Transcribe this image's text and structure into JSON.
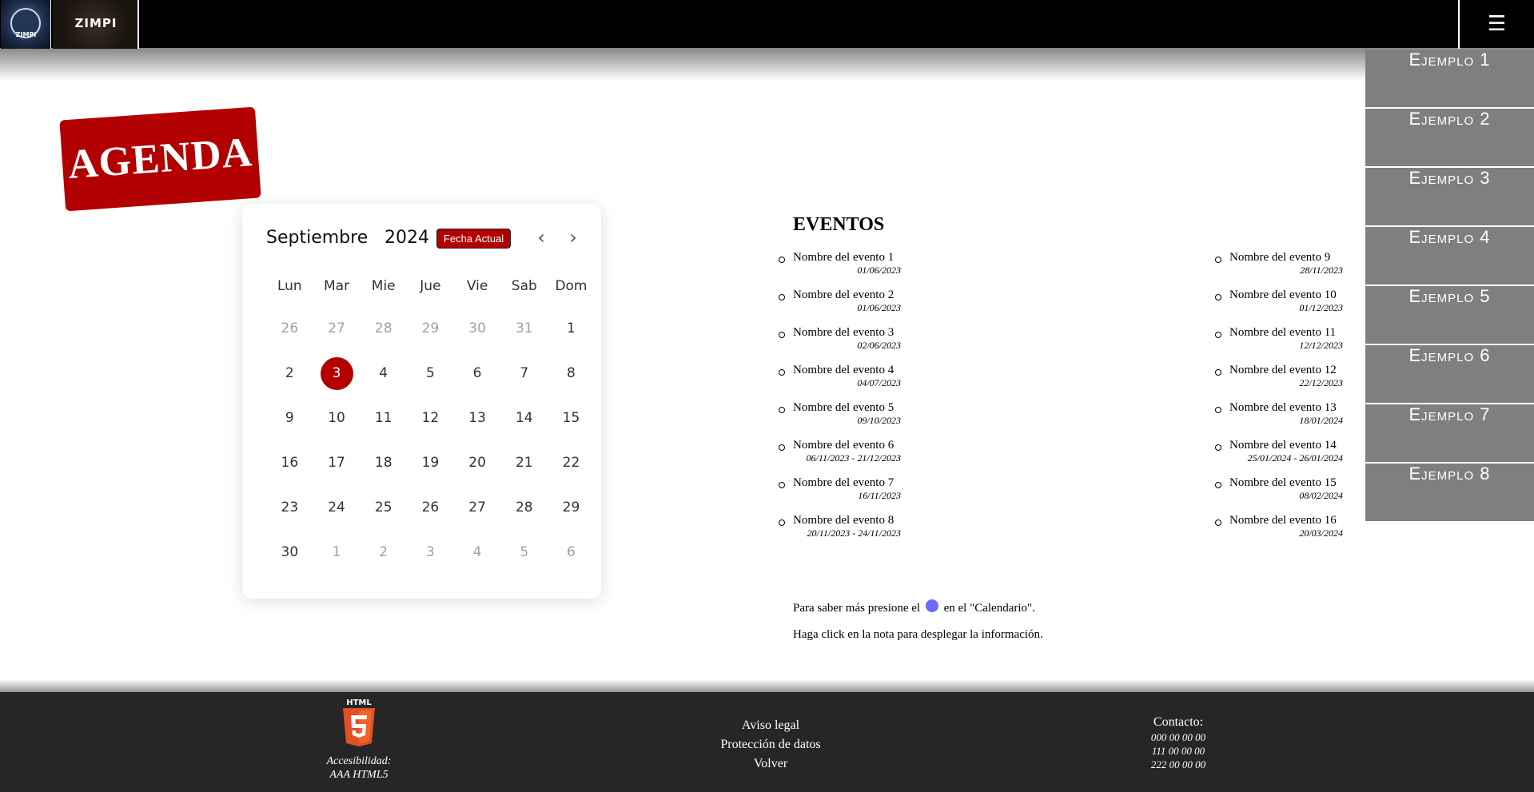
{
  "header": {
    "logo1_text": "ZIMPI",
    "logo2_text": "ZIMPI",
    "menu_icon": "☰"
  },
  "side_menu": [
    "Ejemplo 1",
    "Ejemplo 2",
    "Ejemplo 3",
    "Ejemplo 4",
    "Ejemplo 5",
    "Ejemplo 6",
    "Ejemplo 7",
    "Ejemplo 8"
  ],
  "stamp": "AGENDA",
  "calendar": {
    "month": "Septiembre",
    "year": "2024",
    "today_button": "Fecha Actual",
    "prev_icon": "‹",
    "next_icon": "›",
    "weekdays": [
      "Lun",
      "Mar",
      "Mie",
      "Jue",
      "Vie",
      "Sab",
      "Dom"
    ],
    "days": [
      {
        "d": "26",
        "m": true
      },
      {
        "d": "27",
        "m": true
      },
      {
        "d": "28",
        "m": true
      },
      {
        "d": "29",
        "m": true
      },
      {
        "d": "30",
        "m": true
      },
      {
        "d": "31",
        "m": true
      },
      {
        "d": "1"
      },
      {
        "d": "2"
      },
      {
        "d": "3",
        "sel": true
      },
      {
        "d": "4"
      },
      {
        "d": "5"
      },
      {
        "d": "6"
      },
      {
        "d": "7"
      },
      {
        "d": "8"
      },
      {
        "d": "9"
      },
      {
        "d": "10"
      },
      {
        "d": "11"
      },
      {
        "d": "12"
      },
      {
        "d": "13"
      },
      {
        "d": "14"
      },
      {
        "d": "15"
      },
      {
        "d": "16"
      },
      {
        "d": "17"
      },
      {
        "d": "18"
      },
      {
        "d": "19"
      },
      {
        "d": "20"
      },
      {
        "d": "21"
      },
      {
        "d": "22"
      },
      {
        "d": "23"
      },
      {
        "d": "24"
      },
      {
        "d": "25"
      },
      {
        "d": "26"
      },
      {
        "d": "27"
      },
      {
        "d": "28"
      },
      {
        "d": "29"
      },
      {
        "d": "30"
      },
      {
        "d": "1",
        "m": true
      },
      {
        "d": "2",
        "m": true
      },
      {
        "d": "3",
        "m": true
      },
      {
        "d": "4",
        "m": true
      },
      {
        "d": "5",
        "m": true
      },
      {
        "d": "6",
        "m": true
      }
    ],
    "selected_color": "#b30000"
  },
  "events": {
    "title": "EVENTOS",
    "left": [
      {
        "name": "Nombre del evento 1",
        "date": "01/06/2023"
      },
      {
        "name": "Nombre del evento 2",
        "date": "01/06/2023"
      },
      {
        "name": "Nombre del evento 3",
        "date": "02/06/2023"
      },
      {
        "name": "Nombre del evento 4",
        "date": "04/07/2023"
      },
      {
        "name": "Nombre del evento 5",
        "date": "09/10/2023"
      },
      {
        "name": "Nombre del evento 6",
        "date": "06/11/2023 - 21/12/2023"
      },
      {
        "name": "Nombre del evento 7",
        "date": "16/11/2023"
      },
      {
        "name": "Nombre del evento 8",
        "date": "20/11/2023 - 24/11/2023"
      }
    ],
    "right": [
      {
        "name": "Nombre del evento 9",
        "date": "28/11/2023"
      },
      {
        "name": "Nombre del evento 10",
        "date": "01/12/2023"
      },
      {
        "name": "Nombre del evento 11",
        "date": "12/12/2023"
      },
      {
        "name": "Nombre del evento 12",
        "date": "22/12/2023"
      },
      {
        "name": "Nombre del evento 13",
        "date": "18/01/2024"
      },
      {
        "name": "Nombre del evento 14",
        "date": "25/01/2024 - 26/01/2024"
      },
      {
        "name": "Nombre del evento 15",
        "date": "08/02/2024"
      },
      {
        "name": "Nombre del evento 16",
        "date": "20/03/2024"
      }
    ]
  },
  "info": {
    "line1_before": "Para saber más presione el",
    "line1_after": "en el \"Calendario\".",
    "line2": "Haga click en la nota para desplegar la información."
  },
  "footer": {
    "html5_label": "HTML",
    "accessibility_line1": "Accesibilidad:",
    "accessibility_line2": "AAA HTML5",
    "links": [
      "Aviso legal",
      "Protección de datos",
      "Volver"
    ],
    "contact_title": "Contacto:",
    "phones": [
      "000 00 00 00",
      "111 00 00 00",
      "222 00 00 00"
    ]
  }
}
